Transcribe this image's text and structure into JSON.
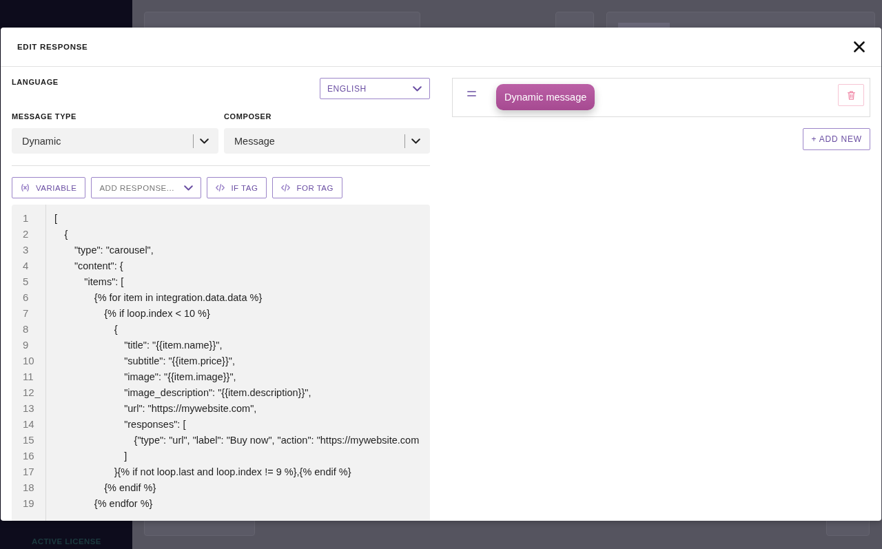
{
  "sidebar": {
    "footer_label": "ACTIVE LICENSE"
  },
  "modal": {
    "title": "EDIT RESPONSE"
  },
  "language": {
    "label": "LANGUAGE",
    "value": "ENGLISH"
  },
  "selects": [
    {
      "label": "MESSAGE TYPE",
      "value": "Dynamic"
    },
    {
      "label": "COMPOSER",
      "value": "Message"
    }
  ],
  "toolbar": [
    {
      "kind": "variable",
      "label": "VARIABLE"
    },
    {
      "kind": "dropdown",
      "label": "ADD RESPONSE..."
    },
    {
      "kind": "tag",
      "label": "IF TAG"
    },
    {
      "kind": "tag",
      "label": "FOR TAG"
    }
  ],
  "code_editor": {
    "lines": [
      {
        "number": "1",
        "text": "["
      },
      {
        "number": "2",
        "text": "    {"
      },
      {
        "number": "3",
        "text": "        \"type\": \"carousel\","
      },
      {
        "number": "4",
        "text": "        \"content\": {"
      },
      {
        "number": "5",
        "text": "            \"items\": ["
      },
      {
        "number": "6",
        "text": "                {% for item in integration.data.data %}"
      },
      {
        "number": "7",
        "text": "                    {% if loop.index < 10 %}"
      },
      {
        "number": "8",
        "text": "                        {"
      },
      {
        "number": "9",
        "text": "                            \"title\": \"{{item.name}}\","
      },
      {
        "number": "10",
        "text": "                            \"subtitle\": \"{{item.price}}\","
      },
      {
        "number": "11",
        "text": "                            \"image\": \"{{item.image}}\","
      },
      {
        "number": "12",
        "text": "                            \"image_description\": \"{{item.description}}\","
      },
      {
        "number": "13",
        "text": "                            \"url\": \"https://mywebsite.com\","
      },
      {
        "number": "14",
        "text": "                            \"responses\": ["
      },
      {
        "number": "15",
        "text": "                                {\"type\": \"url\", \"label\": \"Buy now\", \"action\": \"https://mywebsite.com"
      },
      {
        "number": "16",
        "text": "                            ]"
      },
      {
        "number": "17",
        "text": "                        }{% if not loop.last and loop.index != 9 %},{% endif %}"
      },
      {
        "number": "18",
        "text": "                    {% endif %}"
      },
      {
        "number": "19",
        "text": "                {% endfor %}"
      }
    ]
  },
  "responses": [
    {
      "label": "Dynamic message"
    }
  ],
  "add_button": {
    "label": "+ ADD NEW"
  }
}
